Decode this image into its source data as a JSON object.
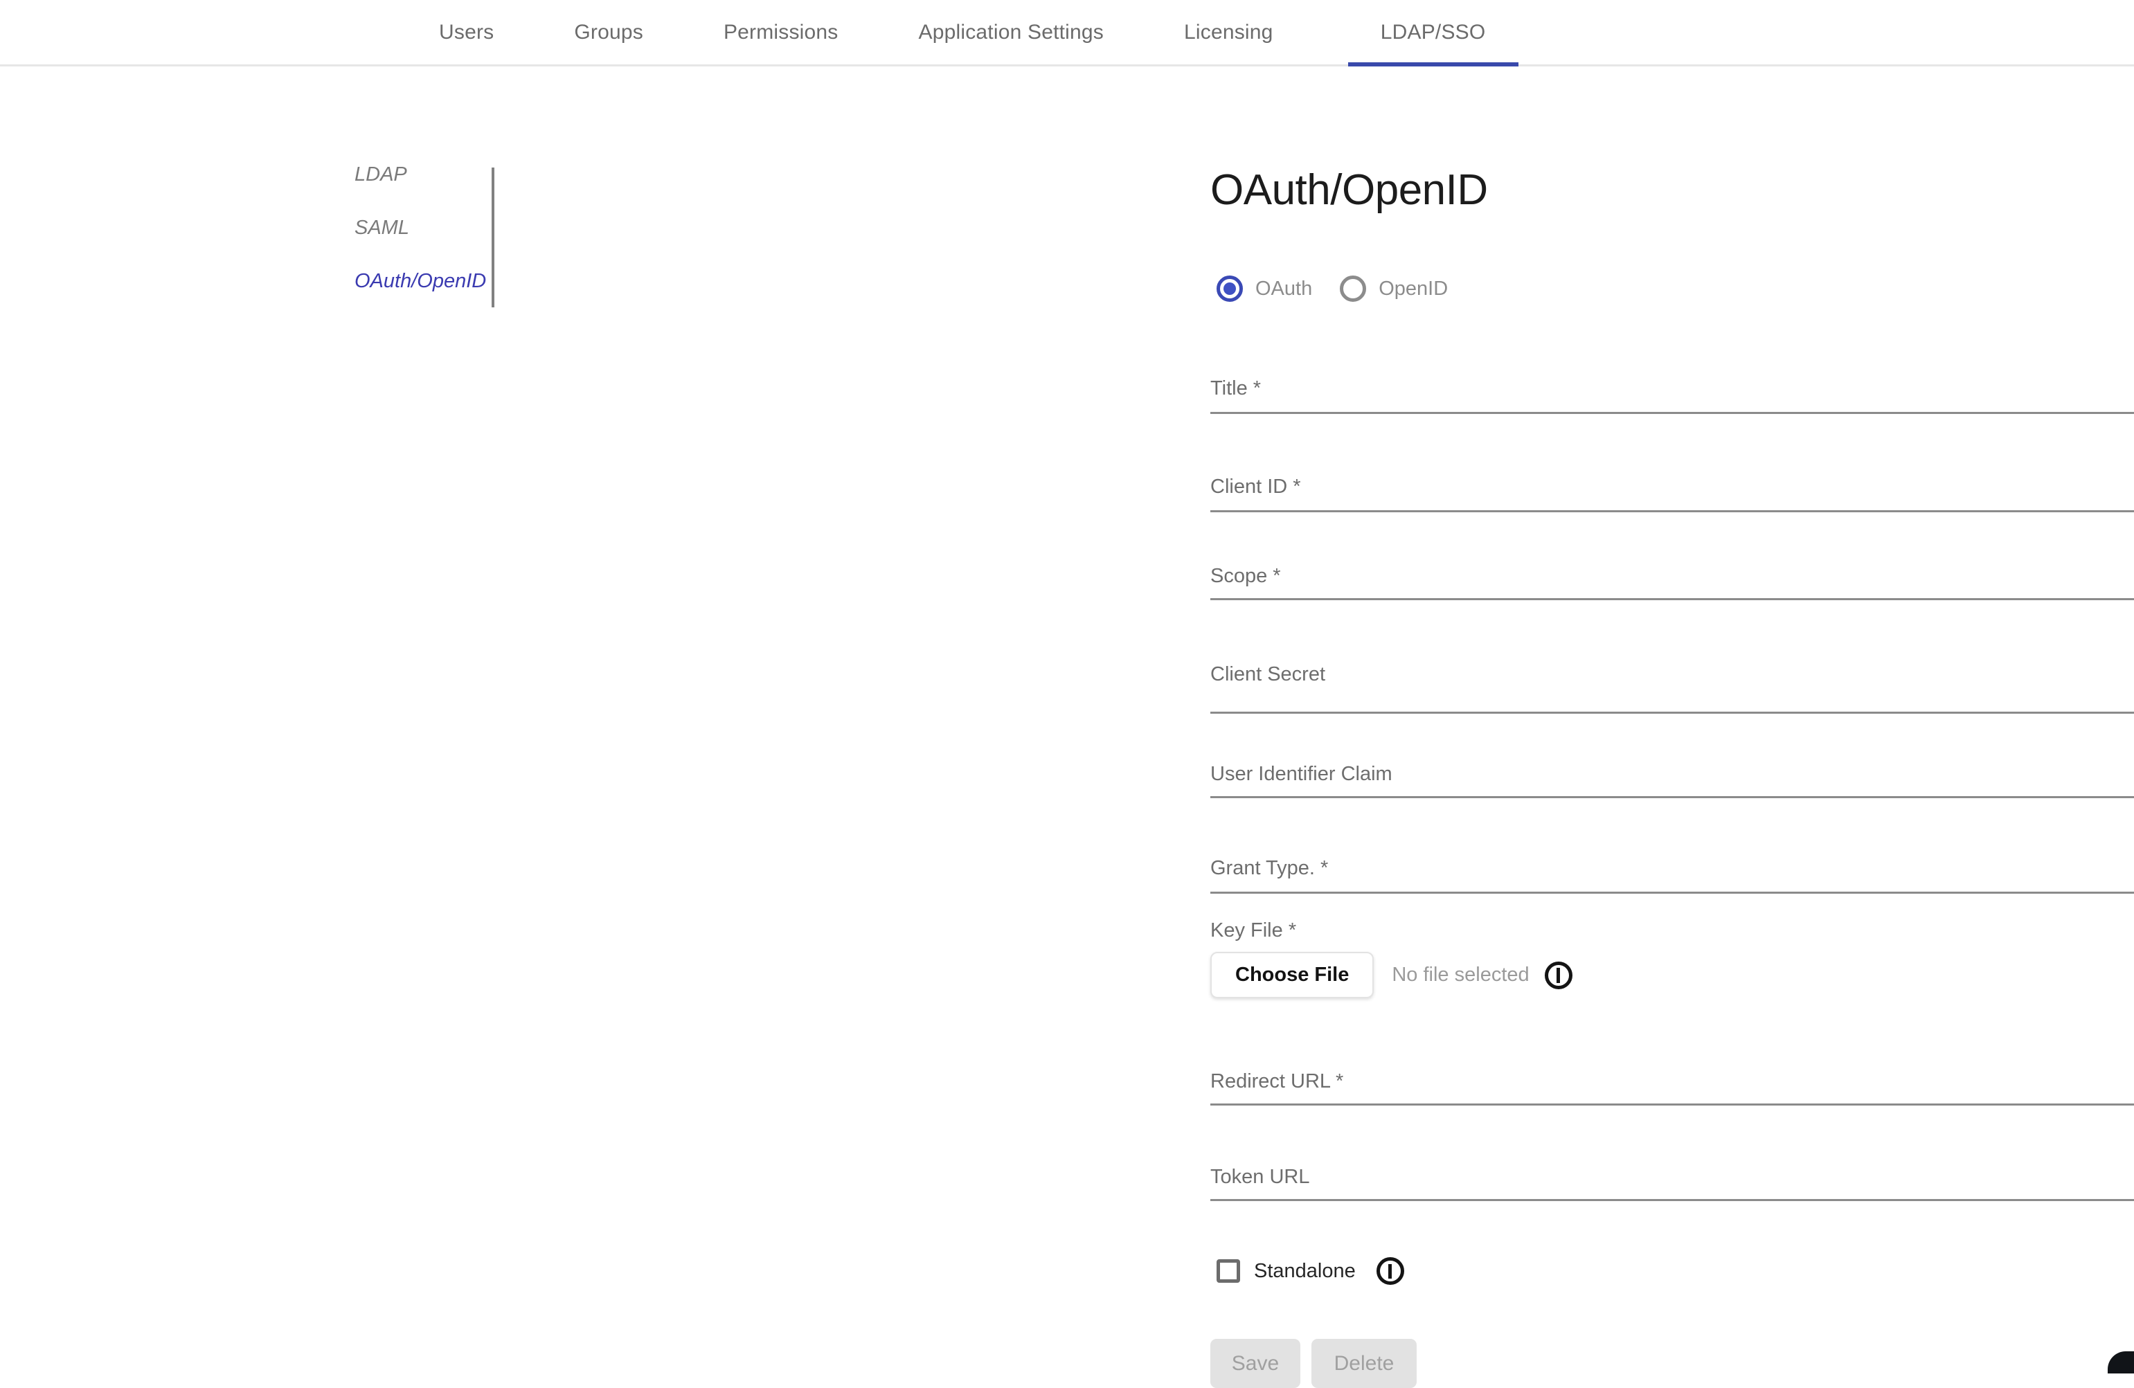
{
  "tabs": [
    {
      "label": "Users",
      "active": false
    },
    {
      "label": "Groups",
      "active": false
    },
    {
      "label": "Permissions",
      "active": false
    },
    {
      "label": "Application Settings",
      "active": false
    },
    {
      "label": "Licensing",
      "active": false
    },
    {
      "label": "LDAP/SSO",
      "active": true
    }
  ],
  "subnav": {
    "items": [
      {
        "label": "LDAP",
        "active": false
      },
      {
        "label": "SAML",
        "active": false
      },
      {
        "label": "OAuth/OpenID",
        "active": true
      }
    ]
  },
  "main": {
    "title": "OAuth/OpenID",
    "mode": {
      "options": [
        {
          "label": "OAuth",
          "selected": true
        },
        {
          "label": "OpenID",
          "selected": false
        }
      ]
    },
    "fields": [
      {
        "label": "Title *",
        "value": "",
        "has_autofill": false,
        "has_info": true,
        "has_caret": false
      },
      {
        "label": "Client ID *",
        "value": "",
        "has_autofill": true,
        "has_info": true,
        "has_caret": false
      },
      {
        "label": "Scope *",
        "value": "",
        "has_autofill": false,
        "has_info": true,
        "has_caret": false
      },
      {
        "label": "Client Secret",
        "value": "",
        "has_autofill": true,
        "has_info": true,
        "has_caret": false
      },
      {
        "label": "User Identifier Claim",
        "value": "",
        "has_autofill": false,
        "has_info": true,
        "has_caret": false
      },
      {
        "label": "Grant Type. *",
        "value": "",
        "has_autofill": false,
        "has_info": true,
        "has_caret": true
      },
      {
        "label": "Redirect URL *",
        "value": "",
        "has_autofill": false,
        "has_info": true,
        "has_caret": false
      },
      {
        "label": "Token URL",
        "value": "",
        "has_autofill": false,
        "has_info": true,
        "has_caret": false
      }
    ],
    "key_file": {
      "label": "Key File *",
      "button_label": "Choose File",
      "status": "No file selected"
    },
    "standalone": {
      "label": "Standalone",
      "checked": false
    },
    "actions": {
      "save_label": "Save",
      "delete_label": "Delete"
    }
  },
  "colors": {
    "accent": "#3949ab",
    "accent_radio": "#3f51c4",
    "subnav_active": "#3a3ab0",
    "label_gray": "#6d6d6d",
    "underline_gray": "#8b8b8b",
    "autofill_red": "#cd4139",
    "disabled_button_bg": "#e2e2e2",
    "disabled_button_text": "#a0a0a0"
  }
}
